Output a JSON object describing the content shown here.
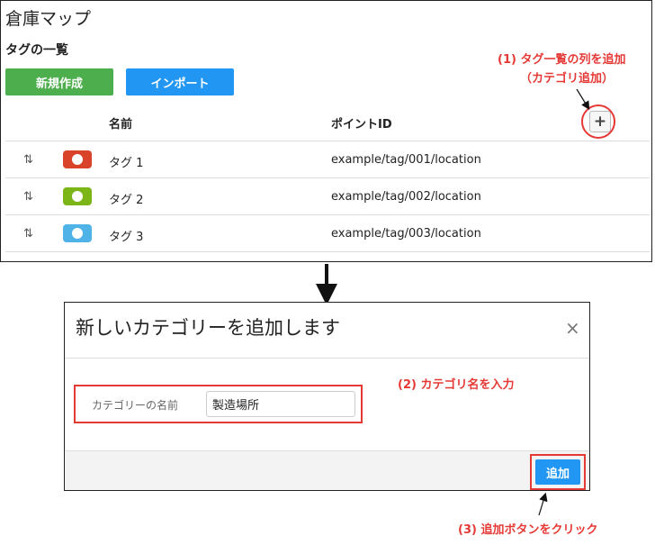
{
  "app": {
    "title": "倉庫マップ"
  },
  "tag_list": {
    "title": "タグの一覧",
    "new_button": "新規作成",
    "import_button": "インポート",
    "columns": {
      "name": "名前",
      "point_id": "ポイントID",
      "add_column": "+"
    },
    "rows": [
      {
        "name": "タグ 1",
        "point_id": "example/tag/001/location",
        "color": "#d9432a"
      },
      {
        "name": "タグ 2",
        "point_id": "example/tag/002/location",
        "color": "#7cb518"
      },
      {
        "name": "タグ 3",
        "point_id": "example/tag/003/location",
        "color": "#4fb3e8"
      }
    ]
  },
  "modal": {
    "title": "新しいカテゴリーを追加します",
    "close": "×",
    "field_label": "カテゴリーの名前",
    "field_value": "製造場所",
    "add_button": "追加"
  },
  "annotations": {
    "step1_line1": "(1) タグ一覧の列を追加",
    "step1_line2": "（カテゴリ追加）",
    "step2": "(2) カテゴリ名を入力",
    "step3": "(3) 追加ボタンをクリック"
  },
  "colors": {
    "green": "#4cae4c",
    "blue": "#2196f3",
    "annotation_red": "#e53935"
  }
}
